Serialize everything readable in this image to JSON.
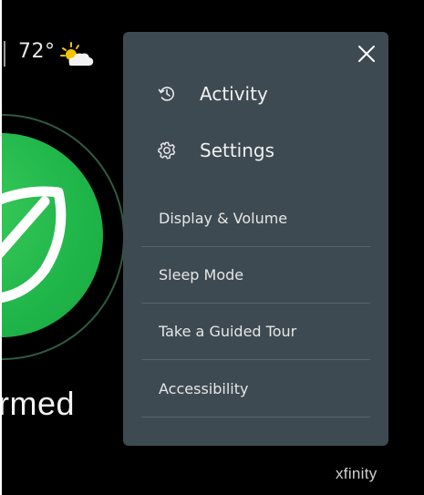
{
  "status_bar": {
    "temperature": "72°",
    "weather_icon": "partly-cloudy-icon"
  },
  "security": {
    "status_text": "rmed",
    "status_color": "#20b64a"
  },
  "menu": {
    "close_icon": "close-icon",
    "primary_items": [
      {
        "label": "Activity",
        "icon": "history-icon"
      },
      {
        "label": "Settings",
        "icon": "gear-icon"
      }
    ],
    "items": [
      {
        "label": "Display & Volume"
      },
      {
        "label": "Sleep Mode"
      },
      {
        "label": "Take a Guided Tour"
      },
      {
        "label": "Accessibility"
      }
    ],
    "background_color": "#3d4a51"
  },
  "brand": {
    "name": "xfinity"
  }
}
